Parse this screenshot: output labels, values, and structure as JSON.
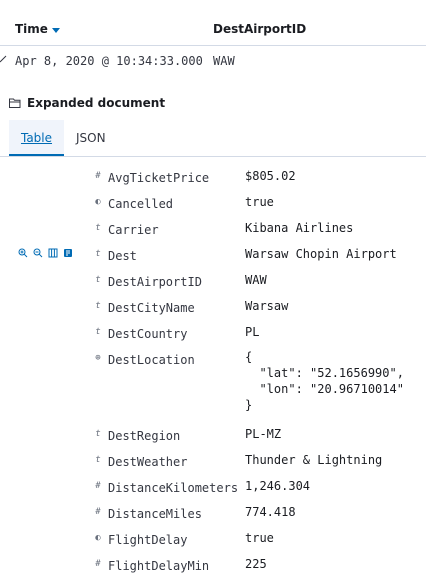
{
  "header": {
    "time_label": "Time",
    "dest_label": "DestAirportID"
  },
  "row": {
    "time": "Apr 8, 2020 @ 10:34:33.000",
    "dest": "WAW"
  },
  "expanded_label": "Expanded document",
  "tabs": [
    {
      "label": "Table",
      "active": true
    },
    {
      "label": "JSON",
      "active": false
    }
  ],
  "fields": [
    {
      "type": "#",
      "name": "AvgTicketPrice",
      "value": "$805.02"
    },
    {
      "type": "◐",
      "name": "Cancelled",
      "value": "true"
    },
    {
      "type": "t",
      "name": "Carrier",
      "value": "Kibana Airlines"
    },
    {
      "type": "t",
      "name": "Dest",
      "value": "Warsaw Chopin Airport"
    },
    {
      "type": "t",
      "name": "DestAirportID",
      "value": "WAW"
    },
    {
      "type": "t",
      "name": "DestCityName",
      "value": "Warsaw"
    },
    {
      "type": "t",
      "name": "DestCountry",
      "value": "PL"
    },
    {
      "type": "⊕",
      "name": "DestLocation",
      "value": "{\n  \"lat\": \"52.1656990\",\n  \"lon\": \"20.96710014\"\n}"
    },
    {
      "type": "t",
      "name": "DestRegion",
      "value": "PL-MZ"
    },
    {
      "type": "t",
      "name": "DestWeather",
      "value": "Thunder & Lightning"
    },
    {
      "type": "#",
      "name": "DistanceKilometers",
      "value": "1,246.304"
    },
    {
      "type": "#",
      "name": "DistanceMiles",
      "value": "774.418"
    },
    {
      "type": "◐",
      "name": "FlightDelay",
      "value": "true"
    },
    {
      "type": "#",
      "name": "FlightDelayMin",
      "value": "225"
    }
  ],
  "icons": {
    "sort": "sort-desc-icon",
    "row_toggle": "row-collapse-icon",
    "folder": "folder-open-icon",
    "filter_for": "magnify-plus-icon",
    "filter_out": "magnify-minus-icon",
    "toggle_column": "table-column-icon",
    "filter_exists": "filter-exists-icon"
  },
  "colors": {
    "accent": "#006bb4",
    "text": "#343741",
    "border": "#d3dae6"
  }
}
